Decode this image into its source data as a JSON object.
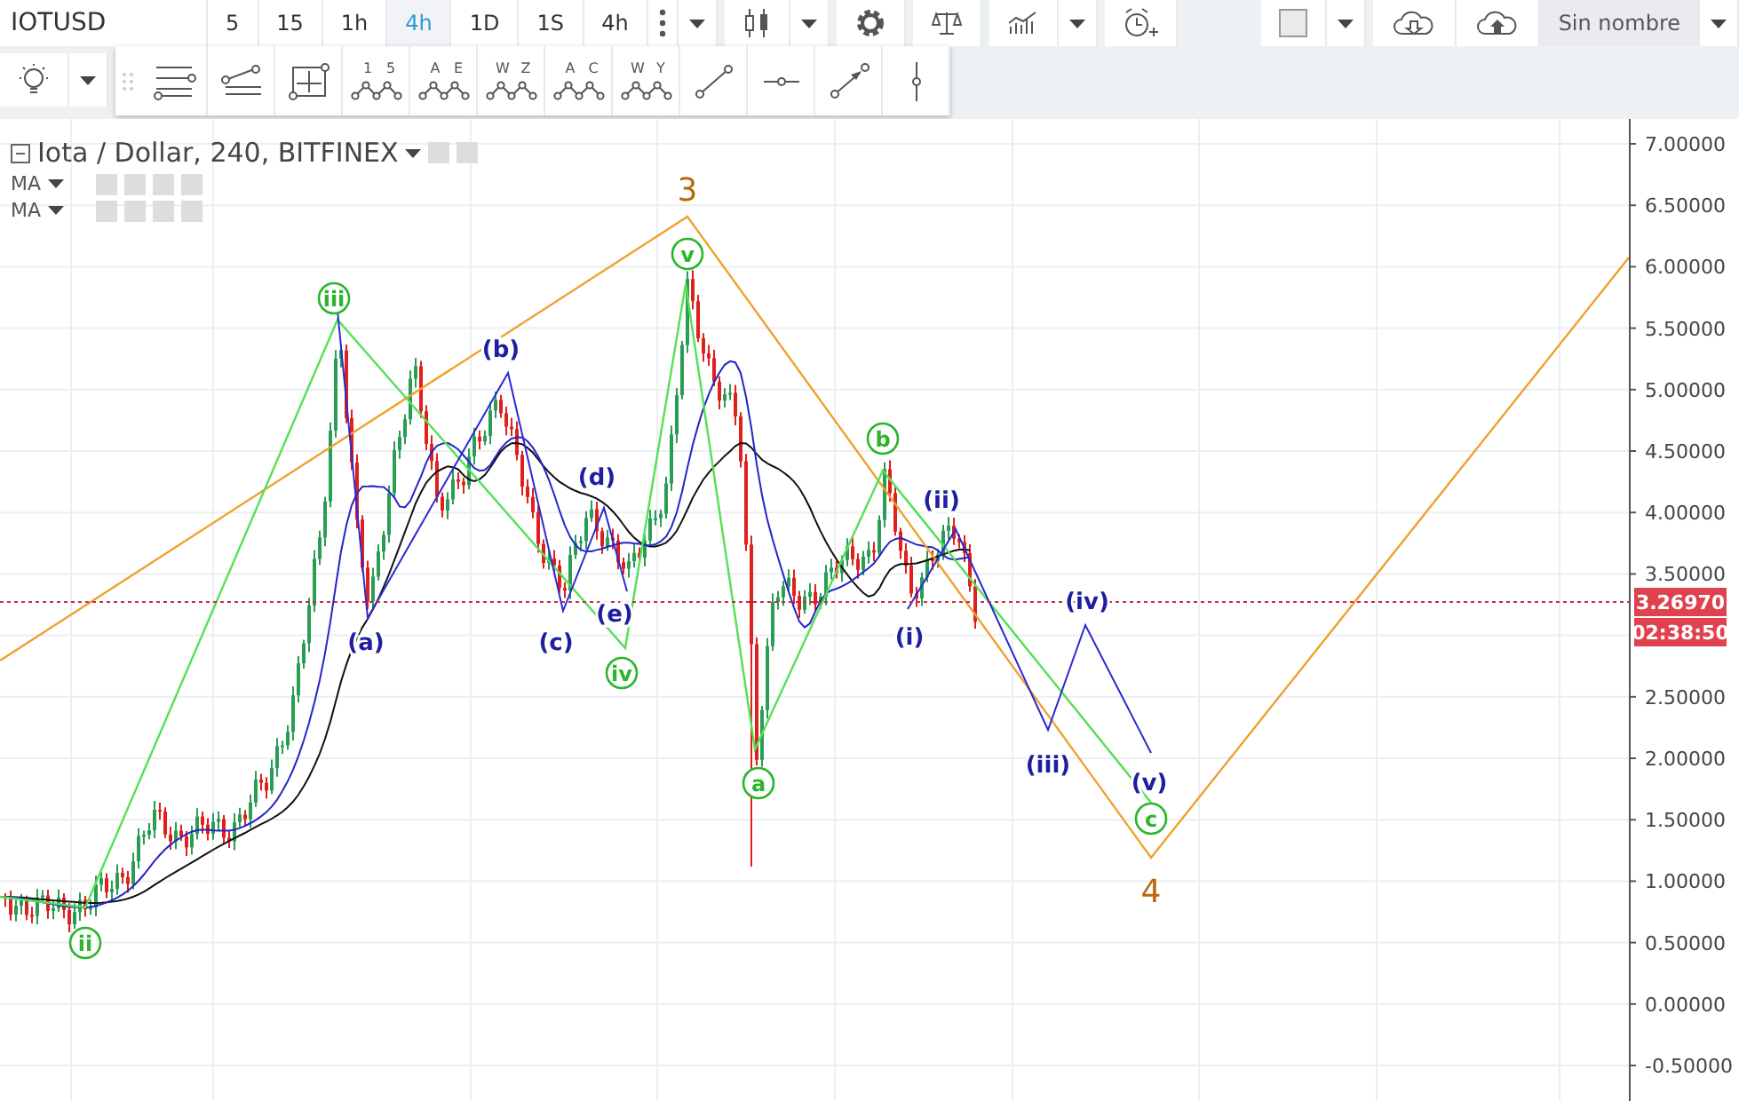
{
  "toolbar": {
    "symbol": "IOTUSD",
    "intervals": [
      {
        "label": "5",
        "selected": false
      },
      {
        "label": "15",
        "selected": false
      },
      {
        "label": "1h",
        "selected": false
      },
      {
        "label": "4h",
        "selected": true
      },
      {
        "label": "1D",
        "selected": false
      },
      {
        "label": "1S",
        "selected": false
      },
      {
        "label": "4h",
        "selected": false
      }
    ],
    "layout_name": "Sin nombre"
  },
  "drawing_tools": [
    {
      "kind": "horizontal-lines"
    },
    {
      "kind": "parallel-channel"
    },
    {
      "kind": "crosshair-box"
    },
    {
      "kind": "wave",
      "labels": [
        "1",
        "5"
      ]
    },
    {
      "kind": "wave",
      "labels": [
        "A",
        "E"
      ]
    },
    {
      "kind": "wave",
      "labels": [
        "W",
        "Z"
      ]
    },
    {
      "kind": "wave",
      "labels": [
        "A",
        "C"
      ]
    },
    {
      "kind": "wave",
      "labels": [
        "W",
        "Y"
      ]
    },
    {
      "kind": "trend-line"
    },
    {
      "kind": "horizontal-ray"
    },
    {
      "kind": "arrow"
    },
    {
      "kind": "vertical-line"
    }
  ],
  "legend": {
    "series": "Iota / Dollar, 240, BITFINEX",
    "indicators": [
      {
        "label": "MA"
      },
      {
        "label": "MA"
      }
    ]
  },
  "chart": {
    "wave_labels": [
      {
        "text": "3",
        "kind": "primary"
      },
      {
        "text": "iii",
        "kind": "circled"
      },
      {
        "text": "v",
        "kind": "circled"
      },
      {
        "text": "(b)",
        "kind": "minor"
      },
      {
        "text": "b",
        "kind": "circled"
      },
      {
        "text": "(d)",
        "kind": "minor"
      },
      {
        "text": "(ii)",
        "kind": "minor"
      },
      {
        "text": "(a)",
        "kind": "minor"
      },
      {
        "text": "(c)",
        "kind": "minor"
      },
      {
        "text": "(e)",
        "kind": "minor"
      },
      {
        "text": "(i)",
        "kind": "minor"
      },
      {
        "text": "(iv)",
        "kind": "minor"
      },
      {
        "text": "iv",
        "kind": "circled"
      },
      {
        "text": "a",
        "kind": "circled"
      },
      {
        "text": "(iii)",
        "kind": "minor"
      },
      {
        "text": "(v)",
        "kind": "minor"
      },
      {
        "text": "c",
        "kind": "circled"
      },
      {
        "text": "4",
        "kind": "primary"
      },
      {
        "text": "ii",
        "kind": "circled"
      }
    ],
    "price_axis": [
      "7.00000",
      "6.50000",
      "6.00000",
      "5.50000",
      "5.00000",
      "4.50000",
      "4.00000",
      "3.50000",
      "2.50000",
      "2.00000",
      "1.50000",
      "1.00000",
      "0.50000",
      "0.00000",
      "-0.50000"
    ],
    "last_price": "3.26970",
    "countdown": "02:38:50"
  }
}
